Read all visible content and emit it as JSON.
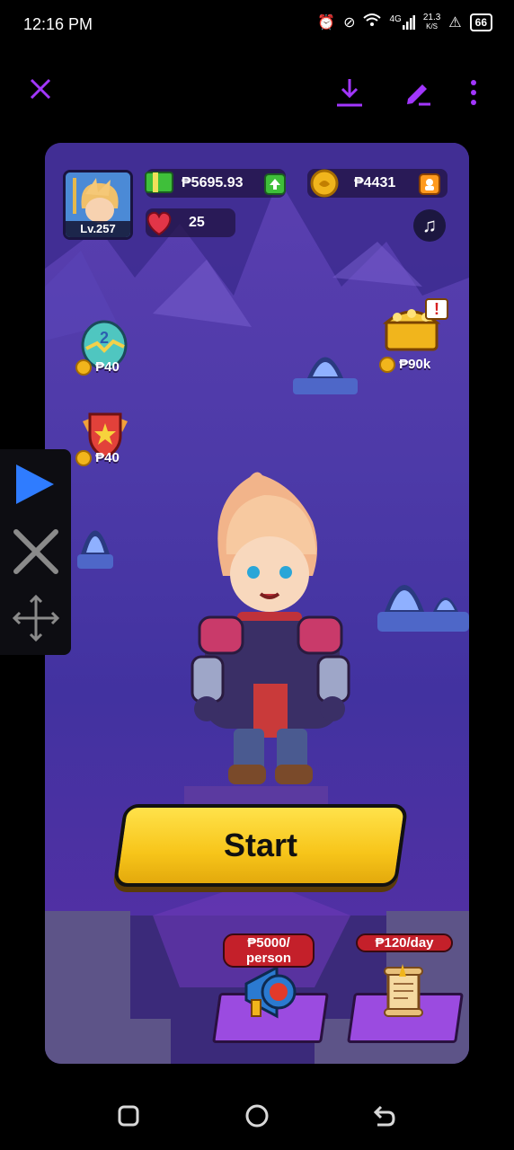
{
  "status_bar": {
    "time": "12:16 PM",
    "network": "4G",
    "speed_value": "21.3",
    "speed_unit": "K/S",
    "battery": "66"
  },
  "top_bar": {
    "close_icon": "close-icon",
    "download_icon": "download-icon",
    "edit_icon": "pencil-icon",
    "more_icon": "more-vertical-icon",
    "accent_color": "#a236ff"
  },
  "game": {
    "player": {
      "level": "Lv.257"
    },
    "cash": "₱5695.93",
    "coins": "₱4431",
    "hearts": "25",
    "music_icon": "music-note-icon",
    "egg_price": "₱40",
    "shield_price": "₱40",
    "chest_price": "₱90k",
    "start_label": "Start",
    "referral_badge_line1": "₱5000/",
    "referral_badge_line2": "person",
    "daily_badge": "₱120/day"
  },
  "side_overlay": {
    "play_icon": "play-icon",
    "close_icon": "close-icon",
    "move_icon": "move-icon"
  },
  "nav_bar": {
    "recents_icon": "recents-icon",
    "home_icon": "home-icon",
    "back_icon": "back-icon"
  }
}
